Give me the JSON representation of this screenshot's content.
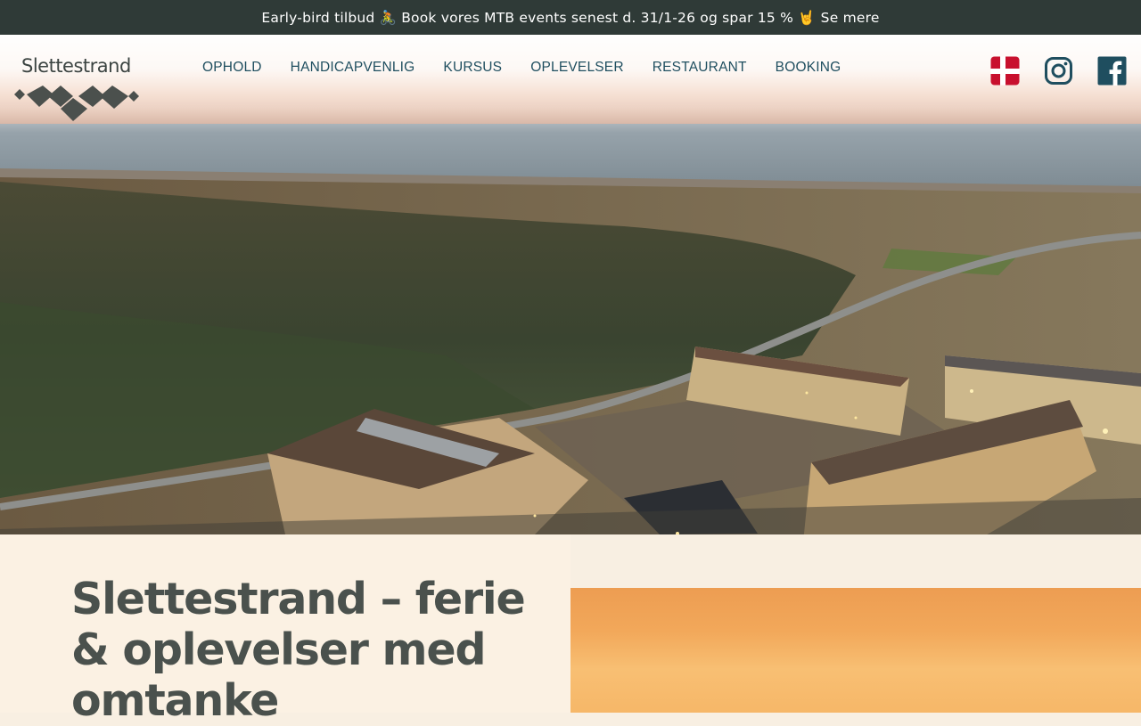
{
  "promo": {
    "text": "Early-bird tilbud 🚴 Book vores MTB events senest d. 31/1-26 og spar 15 % 🤘",
    "link_label": "Se mere"
  },
  "brand": {
    "logo_text": "Slettestrand"
  },
  "nav": {
    "items": [
      "OPHOLD",
      "HANDICAPVENLIG",
      "KURSUS",
      "OPLEVELSER",
      "RESTAURANT",
      "BOOKING"
    ]
  },
  "social": {
    "icons": [
      "danish-flag-icon",
      "instagram-icon",
      "facebook-icon"
    ]
  },
  "intro": {
    "title": "Slettestrand – ferie & oplevelser med omtanke"
  },
  "colors": {
    "promo_bg": "#2f3a37",
    "nav_text": "#1f4e5f",
    "title_text": "#4a514d",
    "panel_bg": "#fbf1e3",
    "flag_red": "#c8102e",
    "social_blue": "#1f4e5f"
  }
}
